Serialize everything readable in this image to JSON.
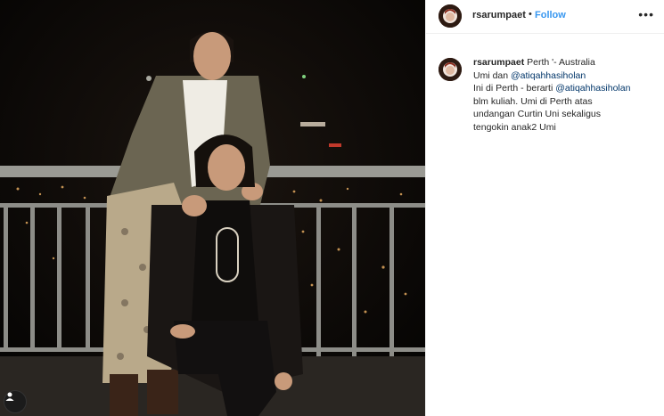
{
  "post": {
    "username": "rsarumpaet",
    "dot": "•",
    "follow_label": "Follow",
    "more_icon": "more-options-icon",
    "caption": {
      "username": "rsarumpaet",
      "location": "Perth '- Australia",
      "line2_prefix": "Umi dan ",
      "line2_mention": "@atiqahhasiholan",
      "line3_prefix": "Ini di Perth - berarti ",
      "line3_mention": "@atiqahhasiholan",
      "line4": "blm kuliah. Umi di Perth atas",
      "line5": "undangan Curtin Uni sekaligus",
      "line6": "tengokin anak2 Umi"
    }
  },
  "colors": {
    "link": "#3897f0",
    "mention": "#003569",
    "text": "#262626"
  }
}
